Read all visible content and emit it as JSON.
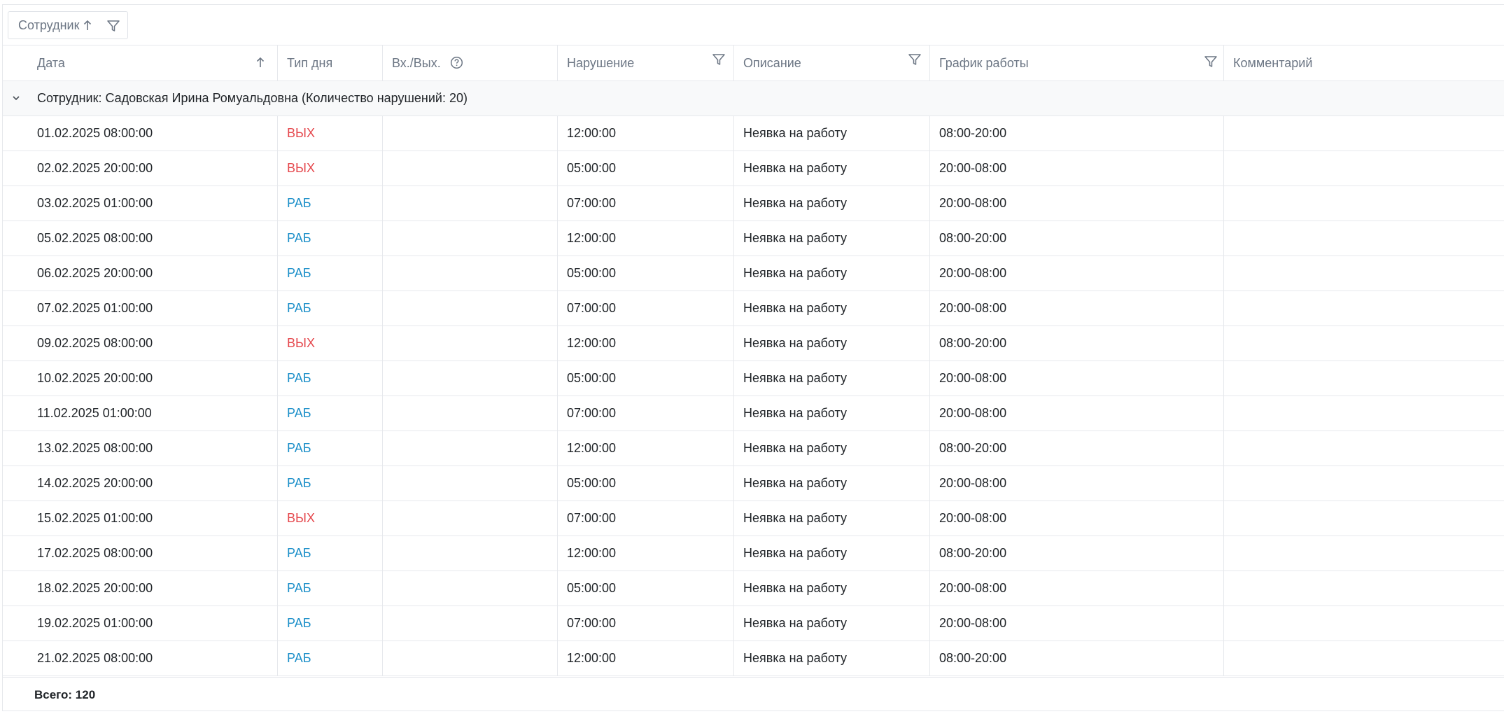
{
  "group_panel": {
    "chip_label": "Сотрудник",
    "sort_icon": "arrow-up-icon",
    "filter_icon": "funnel-icon"
  },
  "columns": [
    {
      "label": "Дата",
      "icon": "sort-ascending-icon"
    },
    {
      "label": "Тип дня"
    },
    {
      "label": "Вх./Вых.",
      "icon": "help-circle-icon"
    },
    {
      "label": "Нарушение",
      "icon": "funnel-icon"
    },
    {
      "label": "Описание",
      "icon": "funnel-icon"
    },
    {
      "label": "График работы",
      "icon": "funnel-icon"
    },
    {
      "label": "Комментарий"
    }
  ],
  "group": {
    "label": "Сотрудник: Садовская Ирина Ромуальдовна (Количество нарушений: 20)",
    "expand_icon": "chevron-down-icon"
  },
  "rows": [
    {
      "date": "01.02.2025 08:00:00",
      "day_type": "ВЫХ",
      "inout": "",
      "violation": "12:00:00",
      "description": "Неявка на работу",
      "schedule": "08:00-20:00",
      "comment": ""
    },
    {
      "date": "02.02.2025 20:00:00",
      "day_type": "ВЫХ",
      "inout": "",
      "violation": "05:00:00",
      "description": "Неявка на работу",
      "schedule": "20:00-08:00",
      "comment": ""
    },
    {
      "date": "03.02.2025 01:00:00",
      "day_type": "РАБ",
      "inout": "",
      "violation": "07:00:00",
      "description": "Неявка на работу",
      "schedule": "20:00-08:00",
      "comment": ""
    },
    {
      "date": "05.02.2025 08:00:00",
      "day_type": "РАБ",
      "inout": "",
      "violation": "12:00:00",
      "description": "Неявка на работу",
      "schedule": "08:00-20:00",
      "comment": ""
    },
    {
      "date": "06.02.2025 20:00:00",
      "day_type": "РАБ",
      "inout": "",
      "violation": "05:00:00",
      "description": "Неявка на работу",
      "schedule": "20:00-08:00",
      "comment": ""
    },
    {
      "date": "07.02.2025 01:00:00",
      "day_type": "РАБ",
      "inout": "",
      "violation": "07:00:00",
      "description": "Неявка на работу",
      "schedule": "20:00-08:00",
      "comment": ""
    },
    {
      "date": "09.02.2025 08:00:00",
      "day_type": "ВЫХ",
      "inout": "",
      "violation": "12:00:00",
      "description": "Неявка на работу",
      "schedule": "08:00-20:00",
      "comment": ""
    },
    {
      "date": "10.02.2025 20:00:00",
      "day_type": "РАБ",
      "inout": "",
      "violation": "05:00:00",
      "description": "Неявка на работу",
      "schedule": "20:00-08:00",
      "comment": ""
    },
    {
      "date": "11.02.2025 01:00:00",
      "day_type": "РАБ",
      "inout": "",
      "violation": "07:00:00",
      "description": "Неявка на работу",
      "schedule": "20:00-08:00",
      "comment": ""
    },
    {
      "date": "13.02.2025 08:00:00",
      "day_type": "РАБ",
      "inout": "",
      "violation": "12:00:00",
      "description": "Неявка на работу",
      "schedule": "08:00-20:00",
      "comment": ""
    },
    {
      "date": "14.02.2025 20:00:00",
      "day_type": "РАБ",
      "inout": "",
      "violation": "05:00:00",
      "description": "Неявка на работу",
      "schedule": "20:00-08:00",
      "comment": ""
    },
    {
      "date": "15.02.2025 01:00:00",
      "day_type": "ВЫХ",
      "inout": "",
      "violation": "07:00:00",
      "description": "Неявка на работу",
      "schedule": "20:00-08:00",
      "comment": ""
    },
    {
      "date": "17.02.2025 08:00:00",
      "day_type": "РАБ",
      "inout": "",
      "violation": "12:00:00",
      "description": "Неявка на работу",
      "schedule": "08:00-20:00",
      "comment": ""
    },
    {
      "date": "18.02.2025 20:00:00",
      "day_type": "РАБ",
      "inout": "",
      "violation": "05:00:00",
      "description": "Неявка на работу",
      "schedule": "20:00-08:00",
      "comment": ""
    },
    {
      "date": "19.02.2025 01:00:00",
      "day_type": "РАБ",
      "inout": "",
      "violation": "07:00:00",
      "description": "Неявка на работу",
      "schedule": "20:00-08:00",
      "comment": ""
    },
    {
      "date": "21.02.2025 08:00:00",
      "day_type": "РАБ",
      "inout": "",
      "violation": "12:00:00",
      "description": "Неявка на работу",
      "schedule": "08:00-20:00",
      "comment": ""
    }
  ],
  "colors": {
    "weekend": "#e5484d",
    "workday": "#1c8fc9",
    "group_background": "#f8f9fa",
    "border": "#e6e8ec"
  },
  "footer": {
    "total": "Всего: 120"
  }
}
